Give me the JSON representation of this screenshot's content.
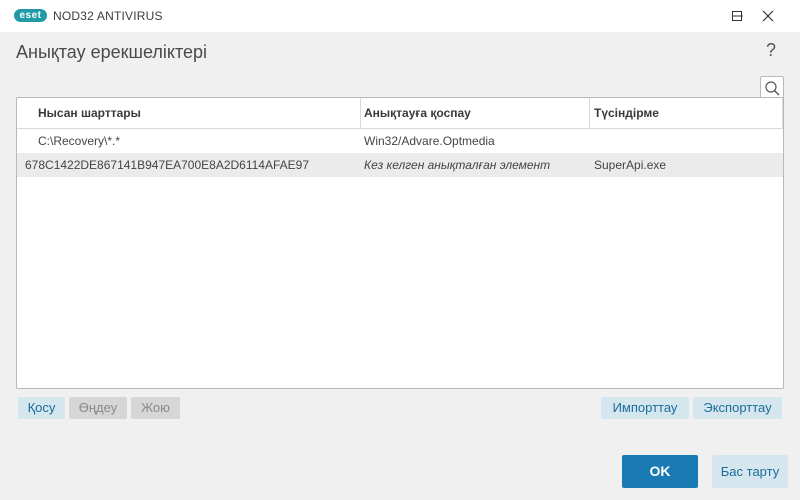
{
  "window": {
    "logo_text": "eset",
    "product_name": "NOD32 ANTIVIRUS"
  },
  "dialog": {
    "title": "Анықтау ерекшеліктері",
    "help_glyph": "?"
  },
  "table": {
    "columns": [
      "Нысан шарттары",
      "Анықтауға қоспау",
      "Түсіндірме"
    ],
    "rows": [
      {
        "object": "C:\\Recovery\\*.*",
        "detection": "Win32/Advare.Optmedia",
        "comment": "",
        "italic_detection": false
      },
      {
        "object": "678C1422DE867141B947EA700E8A2D6114AFAE97",
        "detection": "Кез келген анықталған элемент",
        "comment": "SuperApi.exe",
        "italic_detection": true
      }
    ]
  },
  "actions": {
    "add": "Қосу",
    "edit": "Өңдеу",
    "delete": "Жою",
    "import": "Импорттау",
    "export": "Экспорттау"
  },
  "footer": {
    "ok": "OK",
    "cancel": "Бас тарту"
  },
  "colors": {
    "brand": "#1f9aa6",
    "primary_button": "#1a7bb4",
    "secondary_button_bg": "#d5e6ef",
    "secondary_button_text": "#1a6d98"
  }
}
